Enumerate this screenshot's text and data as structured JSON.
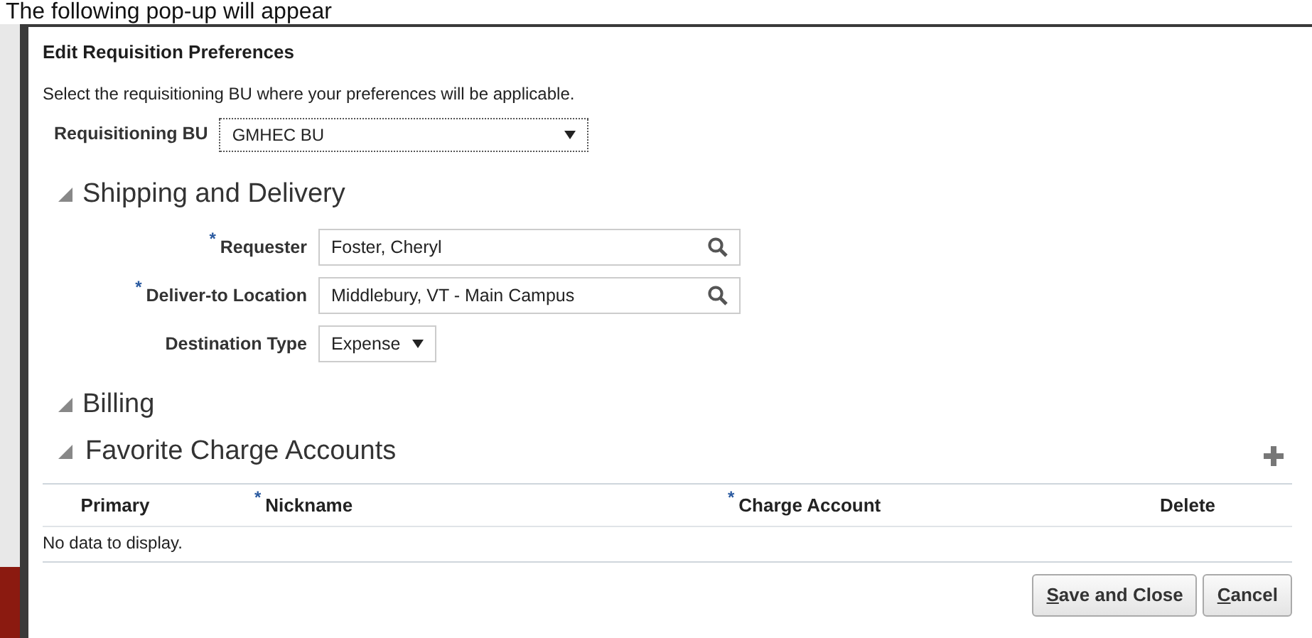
{
  "caption": "The following pop-up will appear",
  "dialog": {
    "title": "Edit Requisition Preferences",
    "instruction": "Select the requisitioning BU where your preferences will be applicable.",
    "bu": {
      "label": "Requisitioning BU",
      "value": "GMHEC BU"
    },
    "sections": [
      {
        "title": "Shipping and Delivery",
        "expanded": true,
        "fields": [
          {
            "kind": "lookup",
            "required_mark": "*",
            "label": "Requester",
            "value": "Foster, Cheryl"
          },
          {
            "kind": "lookup",
            "required_mark": "*",
            "label": "Deliver-to Location",
            "value": "Middlebury, VT - Main Campus"
          },
          {
            "kind": "select",
            "label": "Destination Type",
            "value": "Expense"
          }
        ]
      },
      {
        "title": "Billing",
        "expanded": true
      },
      {
        "title": "Favorite Charge Accounts",
        "expanded": true,
        "table": {
          "columns": [
            {
              "label": "Primary"
            },
            {
              "label": "Nickname",
              "required_mark": "*"
            },
            {
              "label": "Charge Account",
              "required_mark": "*"
            },
            {
              "label": "Delete"
            }
          ],
          "empty_text": "No data to display."
        }
      }
    ],
    "buttons": [
      {
        "parts": [
          {
            "text": "S",
            "underlined": true
          },
          {
            "text": "ave and Close",
            "underlined": false
          }
        ]
      },
      {
        "parts": [
          {
            "text": "C",
            "underlined": true
          },
          {
            "text": "ancel",
            "underlined": false
          }
        ]
      }
    ]
  }
}
